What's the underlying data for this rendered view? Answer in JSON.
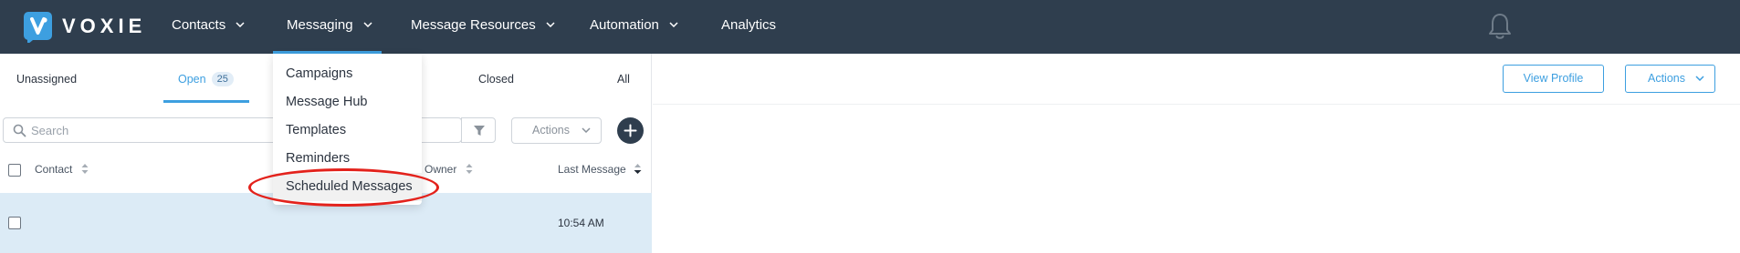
{
  "brand": {
    "name": "VOXIE",
    "logo_icon": "voxie-logo-icon",
    "accent_color": "#3d9fe0",
    "nav_bg": "#2f3e4e"
  },
  "topnav": {
    "items": [
      {
        "label": "Contacts",
        "has_dropdown": true
      },
      {
        "label": "Messaging",
        "has_dropdown": true,
        "active": true
      },
      {
        "label": "Message Resources",
        "has_dropdown": true
      },
      {
        "label": "Automation",
        "has_dropdown": true
      },
      {
        "label": "Analytics",
        "has_dropdown": false
      }
    ],
    "notification_icon": "bell-icon"
  },
  "messaging_menu": {
    "items": [
      {
        "label": "Campaigns"
      },
      {
        "label": "Message Hub"
      },
      {
        "label": "Templates"
      },
      {
        "label": "Reminders"
      },
      {
        "label": "Scheduled Messages",
        "highlighted": true
      }
    ],
    "annotation_color": "#e3221c"
  },
  "inbox": {
    "tabs": [
      {
        "label": "Unassigned"
      },
      {
        "label": "Open",
        "count": "25",
        "active": true
      },
      {
        "label": "Closed"
      },
      {
        "label": "All"
      }
    ],
    "search": {
      "placeholder": "Search",
      "value": ""
    },
    "filter_icon": "filter-icon",
    "actions_label": "Actions",
    "add_icon": "plus-icon",
    "columns": {
      "contact": "Contact",
      "owner": "Owner",
      "last_message": "Last Message"
    },
    "rows": [
      {
        "contact": "",
        "owner": "",
        "last_message": "10:54 AM",
        "selected": false
      }
    ]
  },
  "conversation": {
    "view_profile_label": "View Profile",
    "actions_label": "Actions"
  }
}
